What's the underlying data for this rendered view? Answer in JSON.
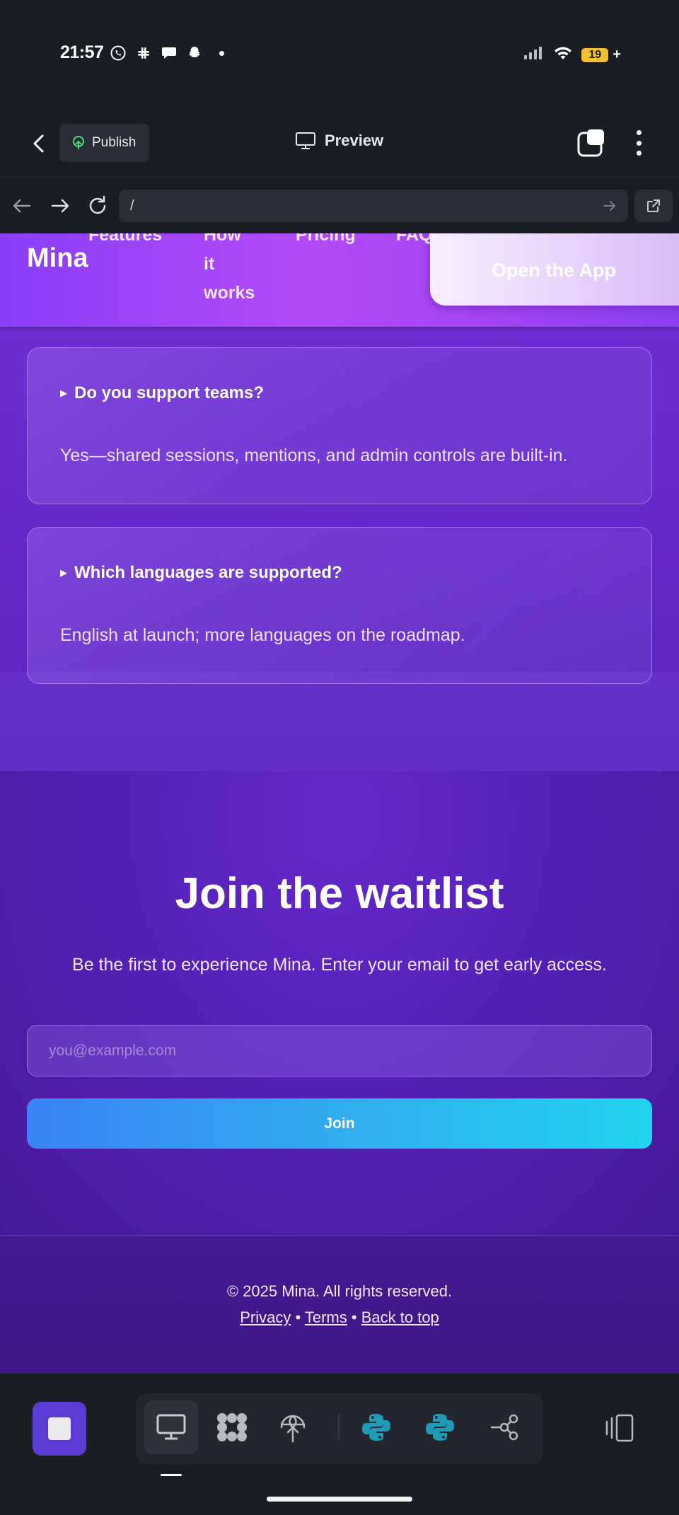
{
  "status_bar": {
    "time": "21:57",
    "battery_level": "19",
    "left_icons": [
      "whatsapp-icon",
      "slack-icon",
      "chat-bubble-icon",
      "snapchat-icon"
    ],
    "right_icons": [
      "signal-icon",
      "wifi-icon",
      "battery-icon"
    ]
  },
  "toolbar": {
    "publish_label": "Publish",
    "preview_label": "Preview"
  },
  "browser": {
    "url": "/"
  },
  "site": {
    "brand": "Mina",
    "nav": [
      "Features",
      "How",
      "it",
      "works",
      "Pricing",
      "FAQ"
    ],
    "open_app_label": "Open the App"
  },
  "faq": [
    {
      "question": "Do you support teams?",
      "answer": "Yes—shared sessions, mentions, and admin controls are built-in."
    },
    {
      "question": "Which languages are supported?",
      "answer": "English at launch; more languages on the roadmap."
    }
  ],
  "waitlist": {
    "title": "Join the waitlist",
    "subtitle": "Be the first to experience Mina. Enter your email to get early access.",
    "email_placeholder": "you@example.com",
    "join_label": "Join"
  },
  "footer": {
    "copyright": "© 2025 Mina. All rights reserved.",
    "privacy": "Privacy",
    "terms": "Terms",
    "back_to_top": "Back to top",
    "separator": "•"
  },
  "colors": {
    "accent": "#5b3ad6",
    "header_gradient_start": "#8a3ef8",
    "join_gradient_start": "#3b82f6",
    "join_gradient_end": "#22d3ee"
  },
  "dock": {
    "items": [
      "monitor-icon",
      "grid-blobs-icon",
      "deploy-icon",
      "python-icon",
      "python-icon",
      "share-nodes-icon"
    ]
  }
}
